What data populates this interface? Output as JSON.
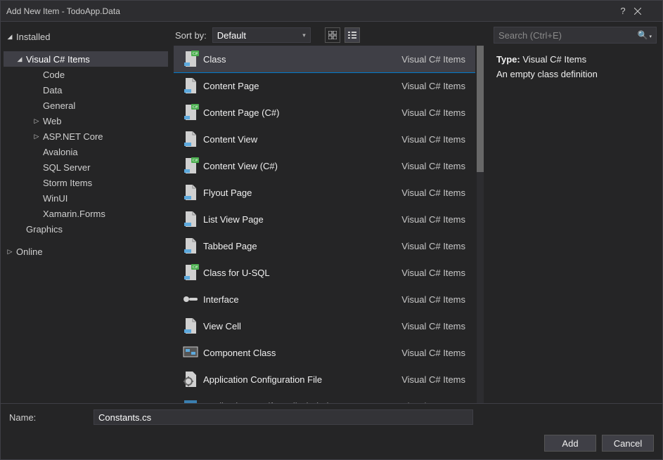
{
  "window": {
    "title": "Add New Item - TodoApp.Data"
  },
  "tree": {
    "installed_label": "Installed",
    "online_label": "Online",
    "csharp_label": "Visual C# Items",
    "children": [
      {
        "label": "Code",
        "indent": 3,
        "arrow": "none"
      },
      {
        "label": "Data",
        "indent": 3,
        "arrow": "none"
      },
      {
        "label": "General",
        "indent": 3,
        "arrow": "none"
      },
      {
        "label": "Web",
        "indent": 3,
        "arrow": "closed"
      },
      {
        "label": "ASP.NET Core",
        "indent": 3,
        "arrow": "closed"
      },
      {
        "label": "Avalonia",
        "indent": 3,
        "arrow": "none"
      },
      {
        "label": "SQL Server",
        "indent": 3,
        "arrow": "none"
      },
      {
        "label": "Storm Items",
        "indent": 3,
        "arrow": "none"
      },
      {
        "label": "WinUI",
        "indent": 3,
        "arrow": "none"
      },
      {
        "label": "Xamarin.Forms",
        "indent": 3,
        "arrow": "none"
      }
    ],
    "graphics_label": "Graphics"
  },
  "sort": {
    "label": "Sort by:",
    "value": "Default"
  },
  "items": [
    {
      "name": "Class",
      "cat": "Visual C# Items",
      "icon": "cs",
      "selected": true
    },
    {
      "name": "Content Page",
      "cat": "Visual C# Items",
      "icon": "xaml"
    },
    {
      "name": "Content Page (C#)",
      "cat": "Visual C# Items",
      "icon": "cs"
    },
    {
      "name": "Content View",
      "cat": "Visual C# Items",
      "icon": "xaml"
    },
    {
      "name": "Content View (C#)",
      "cat": "Visual C# Items",
      "icon": "cs"
    },
    {
      "name": "Flyout Page",
      "cat": "Visual C# Items",
      "icon": "xaml"
    },
    {
      "name": "List View Page",
      "cat": "Visual C# Items",
      "icon": "xaml"
    },
    {
      "name": "Tabbed Page",
      "cat": "Visual C# Items",
      "icon": "xaml"
    },
    {
      "name": "Class for U-SQL",
      "cat": "Visual C# Items",
      "icon": "cs"
    },
    {
      "name": "Interface",
      "cat": "Visual C# Items",
      "icon": "iface"
    },
    {
      "name": "View Cell",
      "cat": "Visual C# Items",
      "icon": "xaml"
    },
    {
      "name": "Component Class",
      "cat": "Visual C# Items",
      "icon": "comp"
    },
    {
      "name": "Application Configuration File",
      "cat": "Visual C# Items",
      "icon": "cfg"
    },
    {
      "name": "Application Manifest File (Windows",
      "cat": "Visual C# Items",
      "icon": "manifest"
    }
  ],
  "search": {
    "placeholder": "Search (Ctrl+E)"
  },
  "info": {
    "type_label": "Type:",
    "type_value": "Visual C# Items",
    "desc": "An empty class definition"
  },
  "footer": {
    "name_label": "Name:",
    "name_value": "Constants.cs",
    "add": "Add",
    "cancel": "Cancel"
  }
}
